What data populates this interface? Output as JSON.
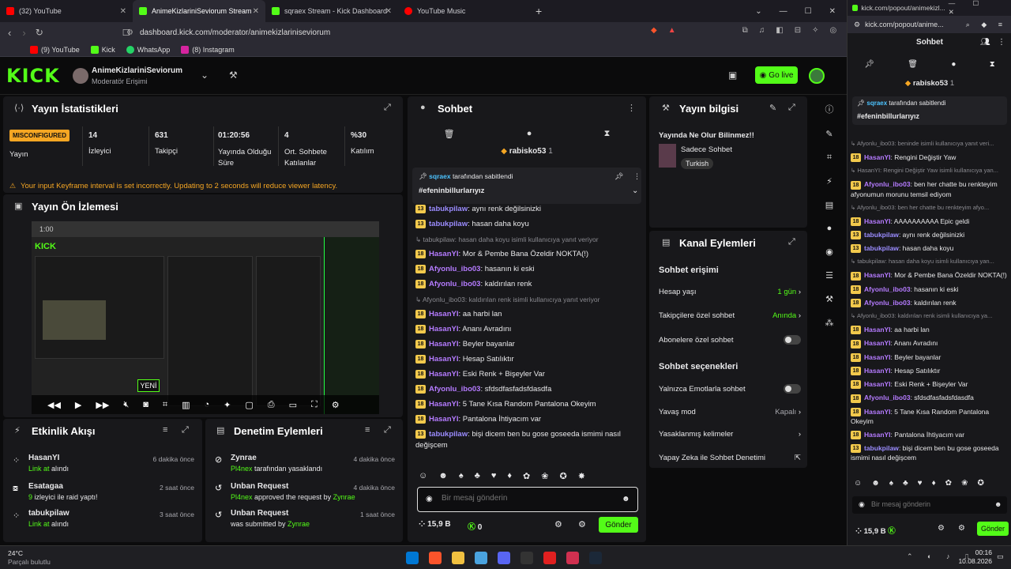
{
  "browser": {
    "tabs": [
      {
        "label": "(32) YouTube",
        "color": "#ff0000"
      },
      {
        "label": "AnimeKizlariniSeviorum Stream",
        "color": "#53fc18"
      },
      {
        "label": "sqraex Stream - Kick Dashboard",
        "color": "#53fc18"
      },
      {
        "label": "YouTube Music",
        "color": "#ff0000"
      }
    ],
    "url": "dashboard.kick.com/moderator/animekizlariniseviorum",
    "bookmarks": [
      "(9) YouTube",
      "Kick",
      "WhatsApp",
      "(8) Instagram"
    ]
  },
  "header": {
    "channel": "AnimeKizlariniSeviorum",
    "role": "Moderatör Erişimi",
    "go_live": "Go live"
  },
  "stats": {
    "title": "Yayın İstatistikleri",
    "status": "MISCONFIGURED",
    "status_label": "Yayın",
    "items": [
      {
        "value": "14",
        "label": "İzleyici"
      },
      {
        "value": "631",
        "label": "Takipçi"
      },
      {
        "value": "01:20:56",
        "label": "Yayında Olduğu Süre"
      },
      {
        "value": "4",
        "label": "Ort. Sohbete Katılanlar"
      },
      {
        "value": "%30",
        "label": "Katılım"
      }
    ],
    "warning": "Your input Keyframe interval is set incorrectly. Updating to 2 seconds will reduce viewer latency."
  },
  "preview": {
    "title": "Yayın Ön İzlemesi",
    "new_label": "YENİ",
    "time": "1:00"
  },
  "activity": {
    "title": "Etkinlik Akışı",
    "items": [
      {
        "name": "HasanYI",
        "action": "Link at",
        "suffix": " alındı",
        "time": "6 dakika önce"
      },
      {
        "name": "Esatagaa",
        "action": "9",
        "suffix": " izleyici ile raid yaptı!",
        "time": "2 saat önce"
      },
      {
        "name": "tabukpilaw",
        "action": "Link at",
        "suffix": " alındı",
        "time": "3 saat önce"
      }
    ]
  },
  "moderation": {
    "title": "Denetim Eylemleri",
    "items": [
      {
        "name": "Zynrae",
        "line2a": "Pl4nex",
        "line2b": " tarafından yasaklandı",
        "line2c": "",
        "time": "4 dakika önce"
      },
      {
        "name": "Unban Request",
        "line2a": "Pl4nex",
        "line2b": " approved the request by ",
        "line2c": "Zynrae",
        "time": "4 dakika önce"
      },
      {
        "name": "Unban Request",
        "line2a": "",
        "line2b": "was submitted by ",
        "line2c": "Zynrae",
        "time": "1 saat önce"
      }
    ]
  },
  "chat": {
    "title": "Sohbet",
    "top_user": "rabisko53",
    "top_count": "1",
    "pinned_by": "sqraex",
    "pinned_suffix": " tarafından sabitlendi",
    "pinned_msg": "#efeninbillurlarıyız",
    "messages": [
      {
        "badge": "13",
        "user": "tabukpilaw",
        "color": "#9b8cff",
        "text": ": aynı renk değilsinizki"
      },
      {
        "badge": "13",
        "user": "tabukpilaw",
        "color": "#9b8cff",
        "text": ": hasan daha koyu"
      },
      {
        "reply": "tabukpilaw: hasan daha koyu isimli kullanıcıya yanıt veriyor"
      },
      {
        "badge": "18",
        "user": "HasanYI",
        "color": "#b57bff",
        "text": ": Mor & Pembe Bana Özeldir NOKTA(!)"
      },
      {
        "badge": "18",
        "user": "Afyonlu_ibo03",
        "color": "#b57bff",
        "text": ": hasanın ki eski"
      },
      {
        "badge": "18",
        "user": "Afyonlu_ibo03",
        "color": "#b57bff",
        "text": ": kaldırılan renk"
      },
      {
        "reply": "Afyonlu_ibo03: kaldırılan renk isimli kullanıcıya yanıt veriyor"
      },
      {
        "badge": "18",
        "user": "HasanYI",
        "color": "#b57bff",
        "text": ": aa harbi lan"
      },
      {
        "badge": "18",
        "user": "HasanYI",
        "color": "#b57bff",
        "text": ": Ananı Avradını"
      },
      {
        "badge": "18",
        "user": "HasanYI",
        "color": "#b57bff",
        "text": ": Beyler bayanlar"
      },
      {
        "badge": "18",
        "user": "HasanYI",
        "color": "#b57bff",
        "text": ": Hesap Satılıktır"
      },
      {
        "badge": "18",
        "user": "HasanYI",
        "color": "#b57bff",
        "text": ": Eski Renk + Bişeyler Var"
      },
      {
        "badge": "18",
        "user": "Afyonlu_ibo03",
        "color": "#b57bff",
        "text": ": sfdsdfasfadsfdasdfa"
      },
      {
        "badge": "18",
        "user": "HasanYI",
        "color": "#b57bff",
        "text": ": 5 Tane Kısa Random Pantalona Okeyim"
      },
      {
        "badge": "18",
        "user": "HasanYI",
        "color": "#b57bff",
        "text": ": Pantalona İhtiyacım var"
      },
      {
        "badge": "13",
        "user": "tabukpilaw",
        "color": "#9b8cff",
        "text": ": bişi dicem ben bu gose goseeda ismimi nasıl değişcem"
      }
    ],
    "input_placeholder": "Bir mesaj gönderin",
    "points": "15,9 B",
    "kicks": "0",
    "send": "Gönder"
  },
  "info": {
    "title": "Yayın bilgisi",
    "stream_title": "Yayında Ne Olur Bilinmez!!",
    "category": "Sadece Sohbet",
    "tag": "Turkish"
  },
  "channel_actions": {
    "title": "Kanal Eylemleri",
    "access_title": "Sohbet erişimi",
    "rows1": [
      {
        "label": "Hesap yaşı",
        "value": "1 gün"
      },
      {
        "label": "Takipçilere özel sohbet",
        "value": "Anında"
      },
      {
        "label": "Abonelere özel sohbet",
        "value": ""
      }
    ],
    "options_title": "Sohbet seçenekleri",
    "rows2": [
      {
        "label": "Yalnızca Emotlarla sohbet",
        "value": ""
      },
      {
        "label": "Yavaş mod",
        "value": "Kapalı"
      },
      {
        "label": "Yasaklanmış kelimeler",
        "value": ""
      },
      {
        "label": "Yapay Zeka ile Sohbet Denetimi",
        "value": ""
      }
    ]
  },
  "popout": {
    "url": "kick.com/popout/animekizl...",
    "url2": "kick.com/popout/anime...",
    "title": "Sohbet",
    "top_user": "rabisko53",
    "top_count": "1",
    "pinned_by": "sqraex",
    "pinned_suffix": " tarafından sabitlendi",
    "pinned_msg": "#efeninbillurlarıyız",
    "messages": [
      {
        "reply": "Afyonlu_ibo03: beninde isimli kullanıcıya yanıt veri..."
      },
      {
        "badge": "18",
        "user": "HasanYI",
        "color": "#b57bff",
        "text": ": Rengini Değiştir Yaw"
      },
      {
        "reply": "HasanYI: Rengini Değiştir Yaw isimli kullanıcıya yan..."
      },
      {
        "badge": "18",
        "user": "Afyonlu_ibo03",
        "color": "#b57bff",
        "text": ": ben her chatte bu renkteyim afyonumun morunu temsil ediyom"
      },
      {
        "reply": "Afyonlu_ibo03: ben her chatte bu renkteyim afyo..."
      },
      {
        "badge": "18",
        "user": "HasanYI",
        "color": "#b57bff",
        "text": ": AAAAAAAAAA Epic geldi"
      },
      {
        "badge": "13",
        "user": "tabukpilaw",
        "color": "#9b8cff",
        "text": ": aynı renk değilsinizki"
      },
      {
        "badge": "13",
        "user": "tabukpilaw",
        "color": "#9b8cff",
        "text": ": hasan daha koyu"
      },
      {
        "reply": "tabukpilaw: hasan daha koyu isimli kullanıcıya yan..."
      },
      {
        "badge": "18",
        "user": "HasanYI",
        "color": "#b57bff",
        "text": ": Mor & Pembe Bana Özeldir NOKTA(!)"
      },
      {
        "badge": "18",
        "user": "Afyonlu_ibo03",
        "color": "#b57bff",
        "text": ": hasanın ki eski"
      },
      {
        "badge": "18",
        "user": "Afyonlu_ibo03",
        "color": "#b57bff",
        "text": ": kaldırılan renk"
      },
      {
        "reply": "Afyonlu_ibo03: kaldırılan renk isimli kullanıcıya ya..."
      },
      {
        "badge": "18",
        "user": "HasanYI",
        "color": "#b57bff",
        "text": ": aa harbi lan"
      },
      {
        "badge": "18",
        "user": "HasanYI",
        "color": "#b57bff",
        "text": ": Ananı Avradını"
      },
      {
        "badge": "18",
        "user": "HasanYI",
        "color": "#b57bff",
        "text": ": Beyler bayanlar"
      },
      {
        "badge": "18",
        "user": "HasanYI",
        "color": "#b57bff",
        "text": ": Hesap Satılıktır"
      },
      {
        "badge": "18",
        "user": "HasanYI",
        "color": "#b57bff",
        "text": ": Eski Renk + Bişeyler Var"
      },
      {
        "badge": "18",
        "user": "Afyonlu_ibo03",
        "color": "#b57bff",
        "text": ": sfdsdfasfadsfdasdfa"
      },
      {
        "badge": "18",
        "user": "HasanYI",
        "color": "#b57bff",
        "text": ": 5 Tane Kısa Random Pantalona Okeyim"
      },
      {
        "badge": "18",
        "user": "HasanYI",
        "color": "#b57bff",
        "text": ": Pantalona İhtiyacım var"
      },
      {
        "badge": "13",
        "user": "tabukpilaw",
        "color": "#9b8cff",
        "text": ": bişi dicem ben bu gose goseeda ismimi nasıl değişcem"
      }
    ],
    "input_placeholder": "Bir mesaj gönderin",
    "points": "15,9 B",
    "send": "Gönder"
  },
  "taskbar": {
    "temp": "24°C",
    "weather": "Parçalı bulutlu",
    "time": "00:16",
    "date": "10.08.2026"
  }
}
